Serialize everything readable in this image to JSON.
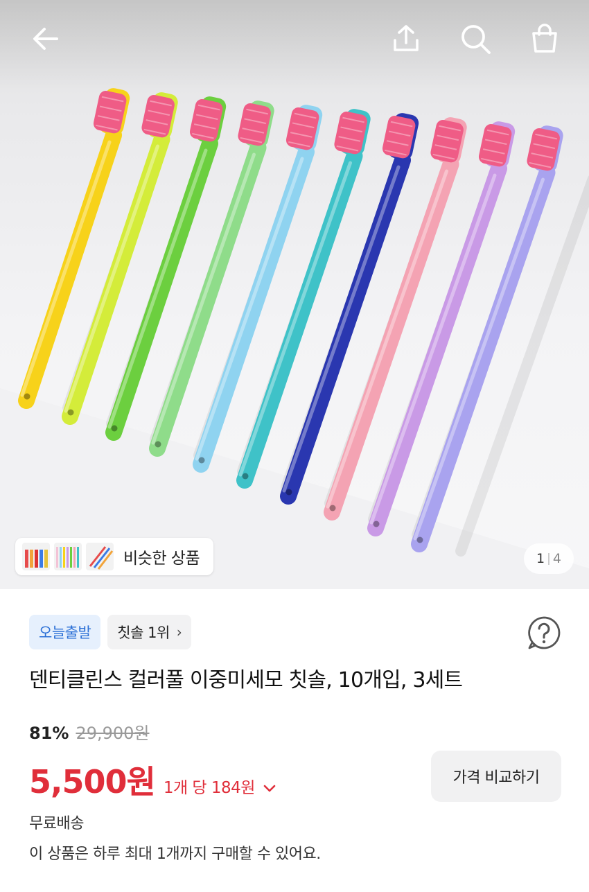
{
  "navigation": {
    "back_icon": "arrow-left-icon",
    "share_icon": "share-icon",
    "search_icon": "search-icon",
    "cart_icon": "shopping-bag-icon"
  },
  "gallery": {
    "similar_label": "비슷한 상품",
    "current_page": "1",
    "total_pages": "4",
    "toothbrush_colors": [
      "#f7d21a",
      "#d4ec3a",
      "#6ccf3f",
      "#8fdc8a",
      "#8fd3f0",
      "#3fc2c8",
      "#2a37b0",
      "#f4a3b3",
      "#c99ae6",
      "#a9a3ef"
    ],
    "bristle_color": "#ef5c86"
  },
  "badges": {
    "today_shipping": "오늘출발",
    "rank": "칫솔 1위"
  },
  "help_icon": "question-circle-icon",
  "product": {
    "title": "덴티클린스 컬러풀 이중미세모 칫솔, 10개입, 3세트",
    "discount_rate": "81%",
    "original_price": "29,900원",
    "sale_price": "5,500원",
    "unit_price": "1개 당 184원",
    "compare_button": "가격 비교하기",
    "shipping": "무료배송",
    "purchase_limit": "이 상품은 하루 최대 1개까지 구매할 수 있어요."
  },
  "colors": {
    "price_red": "#e02e3a",
    "badge_blue": "#2a6fd6"
  }
}
